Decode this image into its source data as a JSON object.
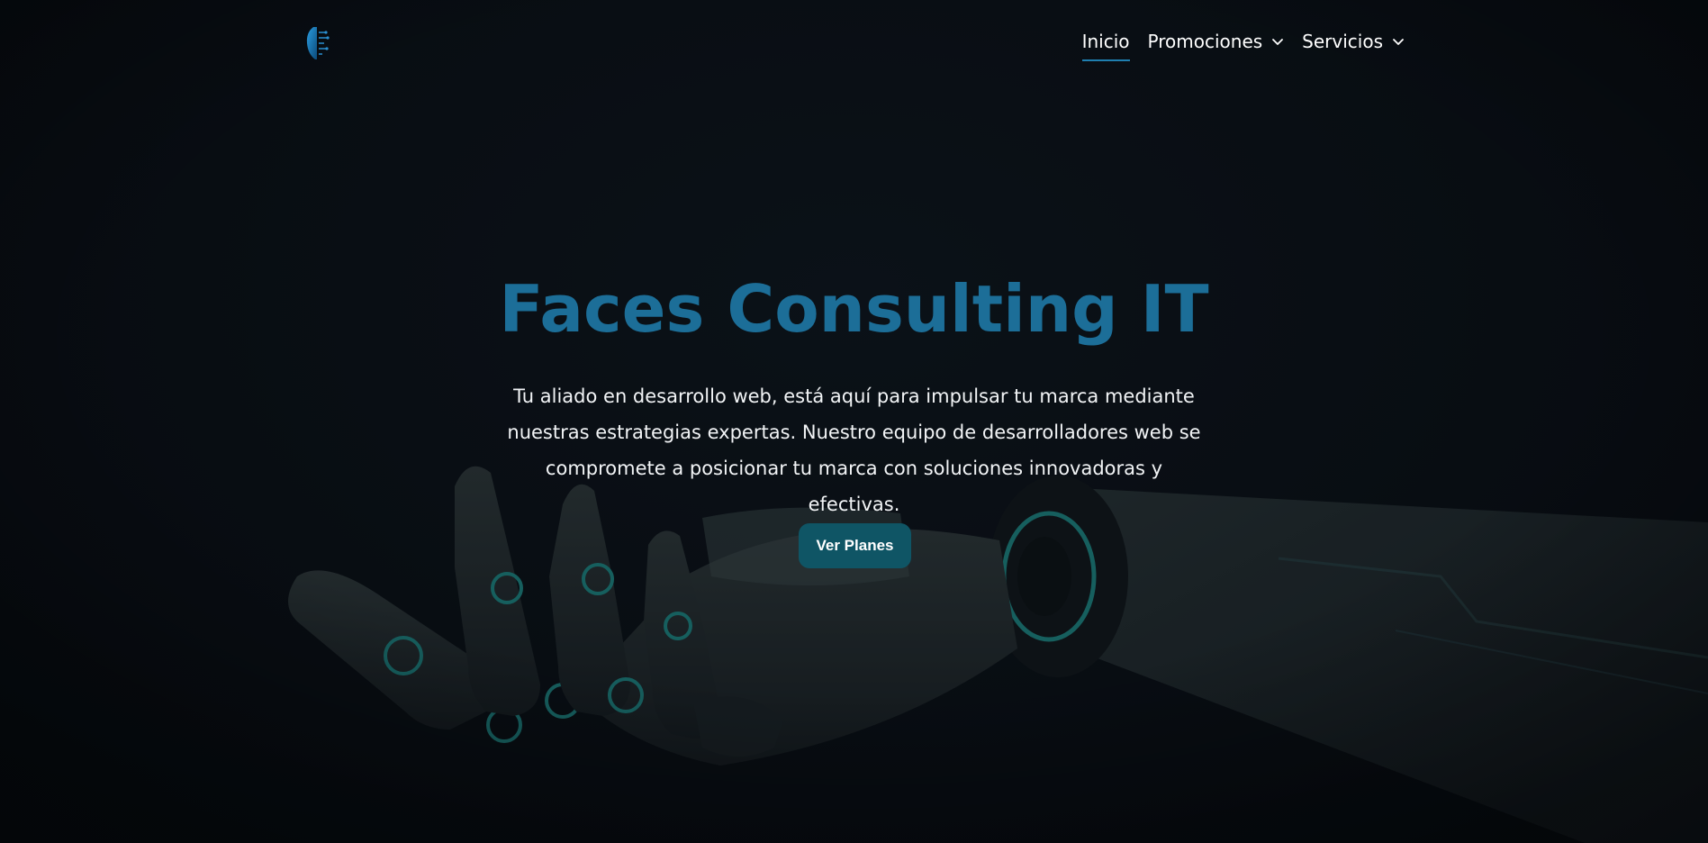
{
  "nav": {
    "items": [
      {
        "label": "Inicio",
        "active": true
      },
      {
        "label": "Promociones",
        "dropdown": true
      },
      {
        "label": "Servicios",
        "dropdown": true
      }
    ]
  },
  "hero": {
    "title": "Faces Consulting IT",
    "description": "Tu aliado en desarrollo web, está aquí para impulsar tu marca mediante nuestras estrategias expertas. Nuestro equipo de desarrolladores web se compromete a posicionar tu marca con soluciones innovadoras y efectivas.",
    "cta_label": "Ver Planes"
  },
  "colors": {
    "background": "#0a0f15",
    "title": "#1c6e98",
    "accent_underline": "#1f7fb0",
    "button": "#0f5565"
  },
  "icons": {
    "logo": "faces-logo-icon",
    "dropdown": "chevron-down-icon",
    "hero_image": "robotic-hand-image"
  }
}
